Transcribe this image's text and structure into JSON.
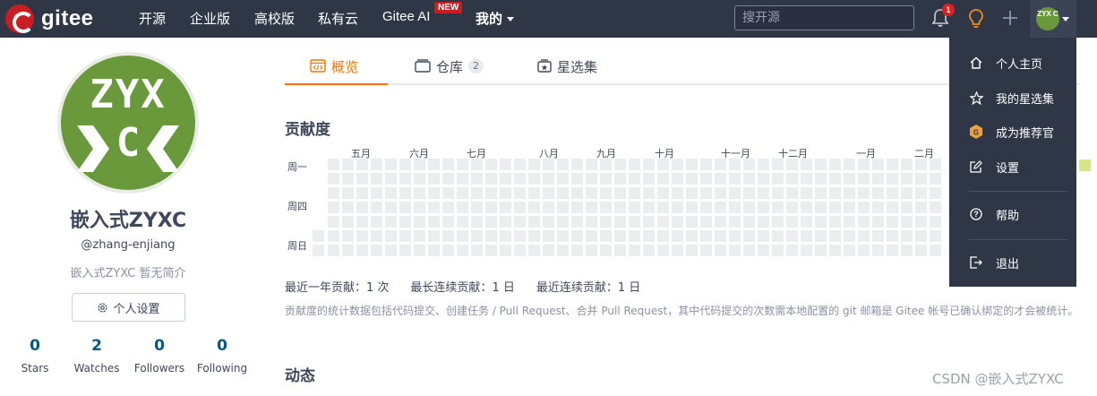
{
  "nav": {
    "logo_text": "gitee",
    "items": [
      {
        "label": "开源"
      },
      {
        "label": "企业版"
      },
      {
        "label": "高校版"
      },
      {
        "label": "私有云"
      },
      {
        "label": "Gitee AI"
      },
      {
        "label": "我的"
      }
    ],
    "new_badge": "NEW",
    "search_placeholder": "搜开源",
    "notification_count": "1",
    "avatar_text": "ZYX C"
  },
  "profile": {
    "avatar_text_top": "ZYX",
    "avatar_text_bottom": "C",
    "name": "嵌入式ZYXC",
    "handle": "@zhang-enjiang",
    "bio": "嵌入式ZYXC 暂无简介",
    "settings_label": "个人设置",
    "stats": [
      {
        "value": "0",
        "label": "Stars"
      },
      {
        "value": "2",
        "label": "Watches"
      },
      {
        "value": "0",
        "label": "Followers"
      },
      {
        "value": "0",
        "label": "Following"
      }
    ]
  },
  "tabs": [
    {
      "label": "概览",
      "icon": "overview-icon",
      "active": true
    },
    {
      "label": "仓库",
      "icon": "repo-icon",
      "count": "2"
    },
    {
      "label": "星选集",
      "icon": "starred-collection-icon"
    }
  ],
  "contribution": {
    "title": "贡献度",
    "months": [
      "五月",
      "六月",
      "七月",
      "八月",
      "九月",
      "十月",
      "十一月",
      "十二月",
      "一月",
      "二月"
    ],
    "days": [
      "周一",
      "周四",
      "周日"
    ],
    "stats": [
      {
        "label": "最近一年贡献：",
        "value": "1 次"
      },
      {
        "label": "最长连续贡献：",
        "value": "1 日"
      },
      {
        "label": "最近连续贡献：",
        "value": "1 日"
      }
    ],
    "note": "贡献度的统计数据包括代码提交、创建任务 / Pull Request、合并 Pull Request，其中代码提交的次数需本地配置的 git 邮箱是 Gitee 帐号已确认绑定的才会被统计。"
  },
  "activity": {
    "title": "动态"
  },
  "dropdown": {
    "items": [
      {
        "label": "个人主页",
        "icon": "home-icon"
      },
      {
        "label": "我的星选集",
        "icon": "star-icon"
      },
      {
        "label": "成为推荐官",
        "icon": "recommender-badge-icon"
      },
      {
        "label": "设置",
        "icon": "edit-settings-icon"
      },
      {
        "label": "帮助",
        "icon": "help-icon"
      },
      {
        "label": "退出",
        "icon": "logout-icon"
      }
    ]
  },
  "watermark": "CSDN @嵌入式ZYXC",
  "colors": {
    "nav_bg": "#2f3646",
    "accent": "#fe7300",
    "brand_red": "#c71d23",
    "avatar_green": "#69993a",
    "stat_blue": "#005980"
  }
}
